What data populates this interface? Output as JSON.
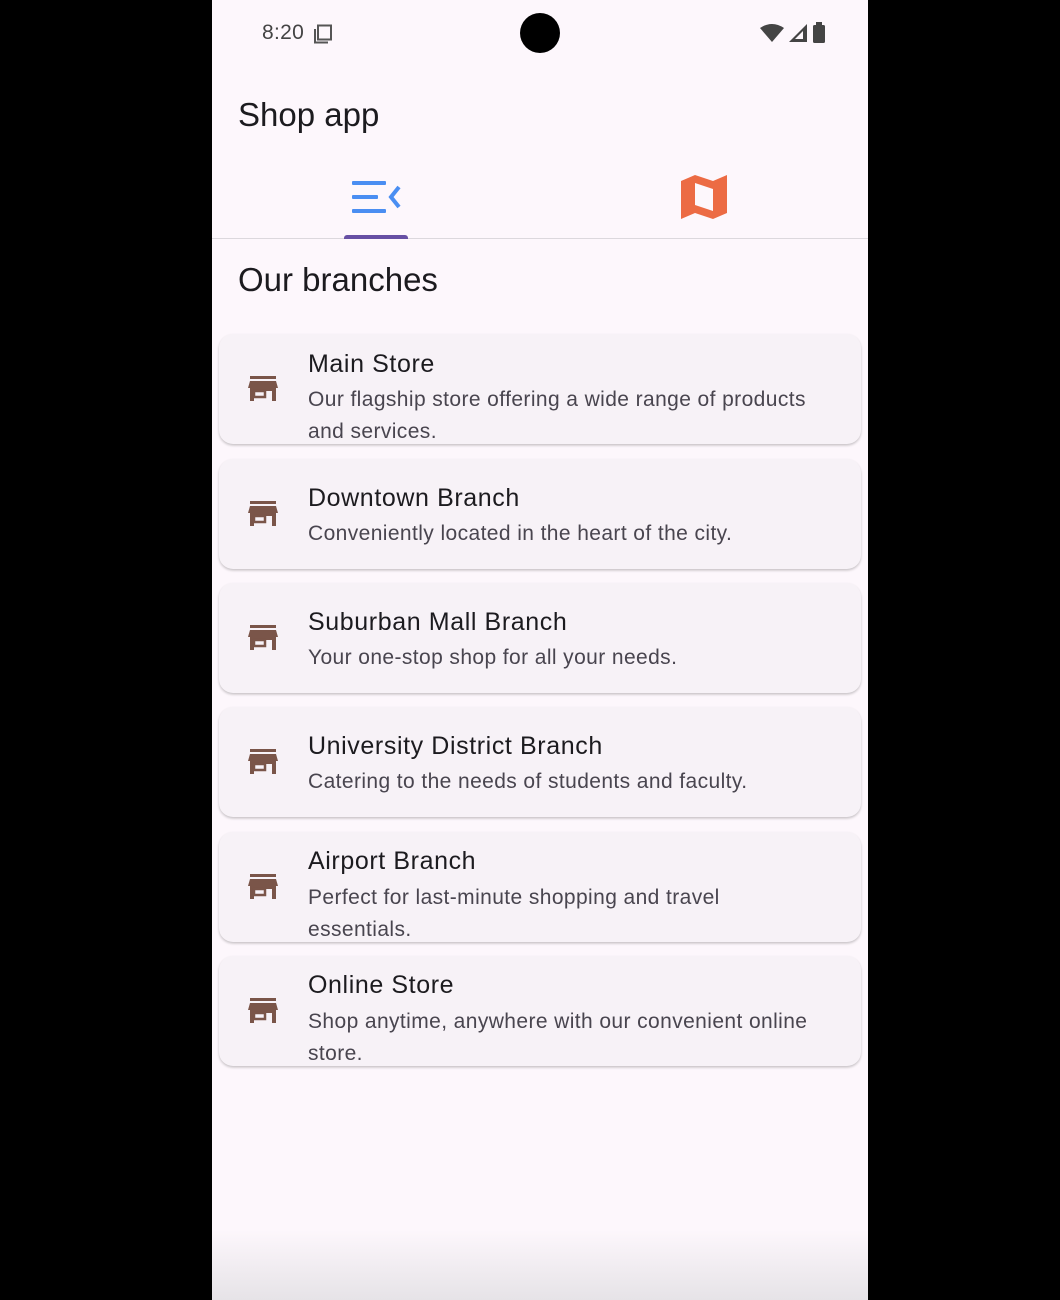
{
  "status_bar": {
    "time": "8:20"
  },
  "app": {
    "title": "Shop app"
  },
  "tabs": [
    {
      "id": "list",
      "icon": "menu-open-icon",
      "color": "#4a8ef2",
      "selected": true
    },
    {
      "id": "map",
      "icon": "map-icon",
      "color": "#ec6b44",
      "selected": false
    }
  ],
  "section": {
    "title": "Our branches"
  },
  "branches": [
    {
      "name": "Main Store",
      "description": "Our flagship store offering a wide range of products and services."
    },
    {
      "name": "Downtown Branch",
      "description": "Conveniently located in the heart of the city."
    },
    {
      "name": "Suburban Mall Branch",
      "description": "Your one-stop shop for all your needs."
    },
    {
      "name": "University District Branch",
      "description": "Catering to the needs of students and faculty."
    },
    {
      "name": "Airport Branch",
      "description": "Perfect for last-minute shopping and travel essentials."
    },
    {
      "name": "Online Store",
      "description": "Shop anytime, anywhere with our convenient online store."
    }
  ],
  "colors": {
    "store_icon": "#7a5549",
    "indicator": "#6750a4",
    "background": "#fdf7fc",
    "card": "#f7f2f7"
  }
}
